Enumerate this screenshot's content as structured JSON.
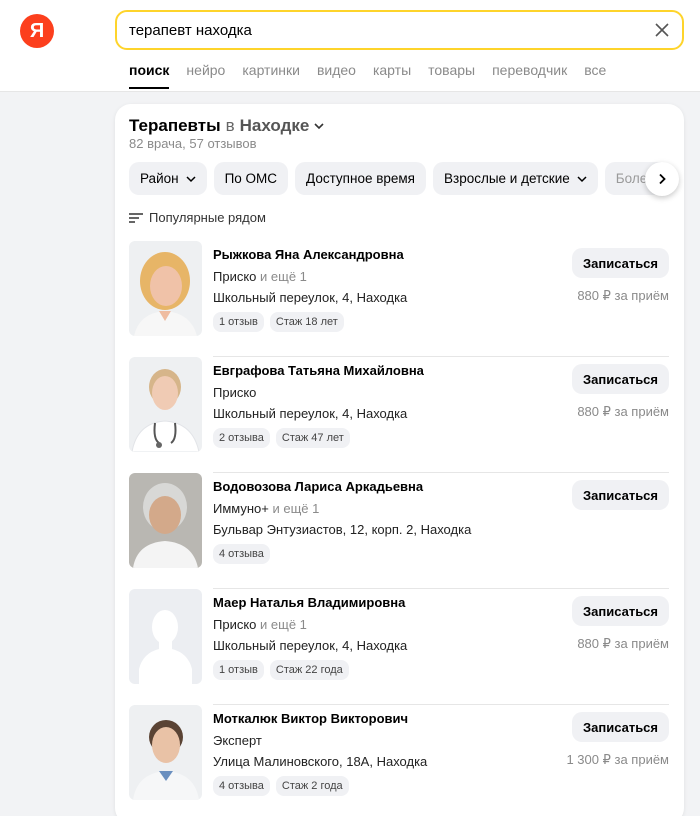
{
  "logo": {
    "letter": "Я"
  },
  "search": {
    "query": "терапевт находка"
  },
  "tabs": [
    {
      "label": "поиск",
      "active": true
    },
    {
      "label": "нейро"
    },
    {
      "label": "картинки"
    },
    {
      "label": "видео"
    },
    {
      "label": "карты"
    },
    {
      "label": "товары"
    },
    {
      "label": "переводчик"
    },
    {
      "label": "все"
    }
  ],
  "card": {
    "title_prefix": "Терапевты",
    "title_in": "в",
    "title_city": "Находке",
    "subtitle": "82 врача, 57 отзывов",
    "filters": [
      {
        "label": "Район",
        "dropdown": true
      },
      {
        "label": "По ОМС"
      },
      {
        "label": "Доступное время"
      },
      {
        "label": "Взрослые и детские",
        "dropdown": true
      },
      {
        "label": "Болезн"
      }
    ],
    "sort_label": "Популярные рядом"
  },
  "doctors": [
    {
      "name": "Рыжкова Яна Александровна",
      "clinic": "Приско",
      "clinic_more": "и ещё 1",
      "address": "Школьный переулок, 4, Находка",
      "badges": [
        "1 отзыв",
        "Стаж 18 лет"
      ],
      "book_label": "Записаться",
      "price": "880 ₽ за приём"
    },
    {
      "name": "Евграфова Татьяна Михайловна",
      "clinic": "Приско",
      "clinic_more": "",
      "address": "Школьный переулок, 4, Находка",
      "badges": [
        "2 отзыва",
        "Стаж 47 лет"
      ],
      "book_label": "Записаться",
      "price": "880 ₽ за приём"
    },
    {
      "name": "Водовозова Лариса Аркадьевна",
      "clinic": "Иммуно+",
      "clinic_more": "и ещё 1",
      "address": "Бульвар Энтузиастов, 12, корп. 2, Находка",
      "badges": [
        "4 отзыва"
      ],
      "book_label": "Записаться",
      "price": ""
    },
    {
      "name": "Маер Наталья Владимировна",
      "clinic": "Приско",
      "clinic_more": "и ещё 1",
      "address": "Школьный переулок, 4, Находка",
      "badges": [
        "1 отзыв",
        "Стаж 22 года"
      ],
      "book_label": "Записаться",
      "price": "880 ₽ за приём"
    },
    {
      "name": "Моткалюк Виктор Викторович",
      "clinic": "Эксперт",
      "clinic_more": "",
      "address": "Улица Малиновского, 18А, Находка",
      "badges": [
        "4 отзыва",
        "Стаж 2 года"
      ],
      "book_label": "Записаться",
      "price": "1 300 ₽ за приём"
    }
  ],
  "colors": {
    "brand": "#fc3f1d",
    "search_border": "#fed42b"
  }
}
